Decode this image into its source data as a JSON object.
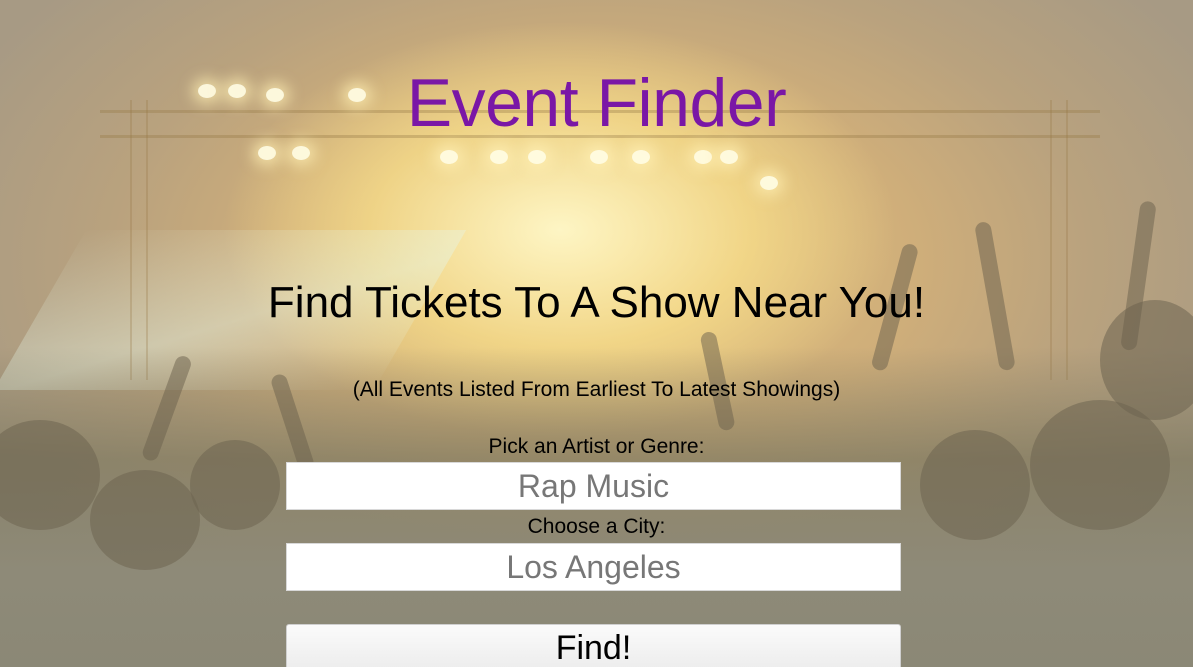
{
  "header": {
    "title": "Event Finder",
    "title_color": "#7a17a6"
  },
  "hero": {
    "headline": "Find Tickets To A Show Near You!",
    "subline": "(All Events Listed From Earliest To Latest Showings)"
  },
  "form": {
    "artist_label": "Pick an Artist or Genre:",
    "artist_placeholder": "Rap Music",
    "city_label": "Choose a City:",
    "city_placeholder": "Los Angeles",
    "submit_label": "Find!"
  }
}
